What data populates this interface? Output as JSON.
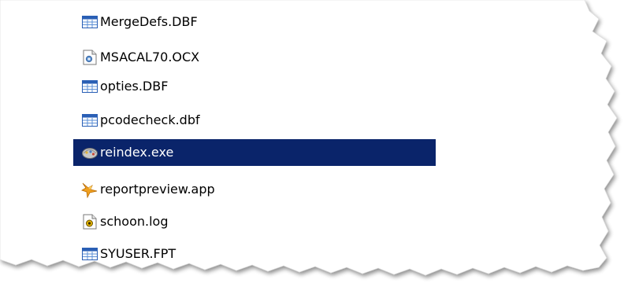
{
  "file_list": {
    "items": [
      {
        "name": "MergeDefs.DBF",
        "icon": "table-file-icon",
        "selected": false
      },
      {
        "name": "MSACAL70.OCX",
        "icon": "activex-control-icon",
        "selected": false
      },
      {
        "name": "opties.DBF",
        "icon": "table-file-icon",
        "selected": false
      },
      {
        "name": "pcodecheck.dbf",
        "icon": "table-file-icon",
        "selected": false
      },
      {
        "name": "reindex.exe",
        "icon": "executable-icon",
        "selected": true
      },
      {
        "name": "reportpreview.app",
        "icon": "foxpro-app-icon",
        "selected": false
      },
      {
        "name": "schoon.log",
        "icon": "log-file-icon",
        "selected": false
      },
      {
        "name": "SYUSER.FPT",
        "icon": "table-file-icon",
        "selected": false
      }
    ]
  },
  "colors": {
    "selection_background": "#0a246a",
    "selection_text": "#ffffff",
    "text": "#000000"
  }
}
